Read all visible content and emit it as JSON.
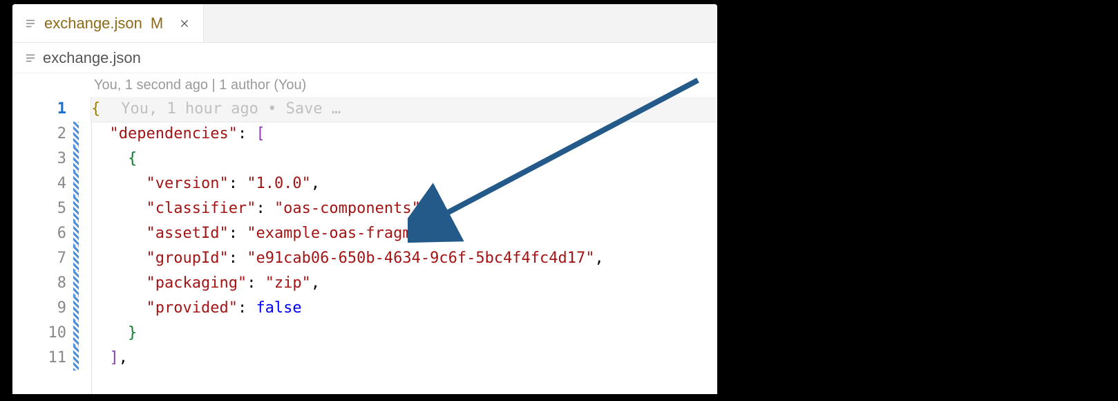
{
  "tab": {
    "filename": "exchange.json",
    "status": "M",
    "close_tooltip": "Close"
  },
  "breadcrumb": {
    "filename": "exchange.json"
  },
  "codelens": {
    "text": "You, 1 second ago | 1 author (You)"
  },
  "inline_blame": {
    "text": "You, 1 hour ago • Save …"
  },
  "line_numbers": [
    "1",
    "2",
    "3",
    "4",
    "5",
    "6",
    "7",
    "8",
    "9",
    "10",
    "11"
  ],
  "code": {
    "l1_open": "{",
    "l2_key": "\"dependencies\"",
    "l2_colon": ": ",
    "l2_open": "[",
    "l3_open": "{",
    "l4_key": "\"version\"",
    "l4_val": "\"1.0.0\"",
    "l5_key": "\"classifier\"",
    "l5_val": "\"oas-components\"",
    "l6_key": "\"assetId\"",
    "l6_val": "\"example-oas-fragment\"",
    "l7_key": "\"groupId\"",
    "l7_val": "\"e91cab06-650b-4634-9c6f-5bc4f4fc4d17\"",
    "l8_key": "\"packaging\"",
    "l8_val": "\"zip\"",
    "l9_key": "\"provided\"",
    "l9_val": "false",
    "l10_close": "}",
    "l11_close": "],",
    "sep": ": ",
    "comma": ","
  },
  "arrow": {
    "color": "#235a8a"
  }
}
